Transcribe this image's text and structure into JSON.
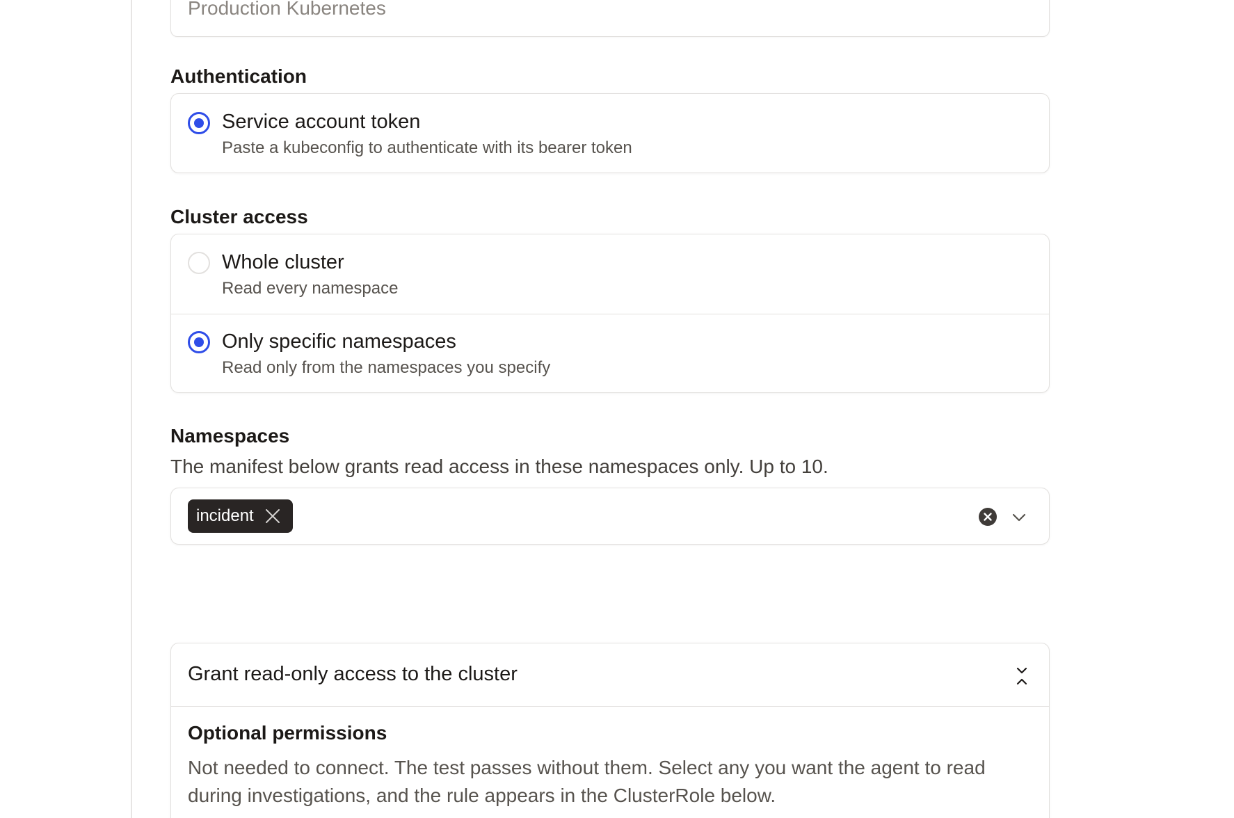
{
  "name_field": {
    "value": "Production Kubernetes"
  },
  "authentication": {
    "label": "Authentication",
    "options": [
      {
        "title": "Service account token",
        "description": "Paste a kubeconfig to authenticate with its bearer token",
        "selected": true
      }
    ]
  },
  "cluster_access": {
    "label": "Cluster access",
    "options": [
      {
        "title": "Whole cluster",
        "description": "Read every namespace",
        "selected": false
      },
      {
        "title": "Only specific namespaces",
        "description": "Read only from the namespaces you specify",
        "selected": true
      }
    ]
  },
  "namespaces": {
    "label": "Namespaces",
    "helper": "The manifest below grants read access in these namespaces only. Up to 10.",
    "selected": [
      "incident"
    ]
  },
  "grant": {
    "title": "Grant read-only access to the cluster",
    "optional_title": "Optional permissions",
    "optional_description": "Not needed to connect. The test passes without them. Select any you want the agent to read during investigations, and the rule appears in the ClusterRole below."
  },
  "colors": {
    "accent": "#2f4de8",
    "chip_bg": "#292524",
    "border": "#e2e0de"
  }
}
